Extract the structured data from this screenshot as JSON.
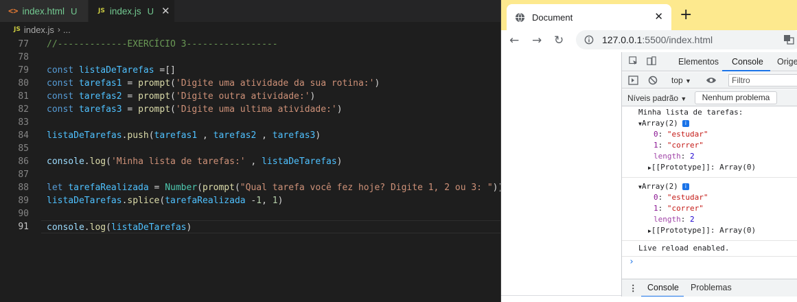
{
  "editor": {
    "tabs": [
      {
        "icon": "html-file-icon",
        "name": "index.html",
        "badge": "U"
      },
      {
        "icon": "js-file-icon",
        "name": "index.js",
        "badge": "U"
      }
    ],
    "js_badge": "JS",
    "breadcrumb": {
      "file": "index.js",
      "rest": "..."
    },
    "lines": [
      {
        "n": "77",
        "parts": [
          [
            "c-com",
            "//-------------EXERCÍCIO 3-----------------"
          ]
        ]
      },
      {
        "n": "78",
        "parts": []
      },
      {
        "n": "79",
        "parts": [
          [
            "c-kw",
            "const "
          ],
          [
            "c-var",
            "listaDeTarefas"
          ],
          [
            "c-p",
            " =[]"
          ]
        ]
      },
      {
        "n": "80",
        "parts": [
          [
            "c-kw",
            "const "
          ],
          [
            "c-var",
            "tarefas1"
          ],
          [
            "c-p",
            " = "
          ],
          [
            "c-fn",
            "prompt"
          ],
          [
            "c-p",
            "("
          ],
          [
            "c-str",
            "'Digite uma atividade da sua rotina:'"
          ],
          [
            "c-p",
            ")"
          ]
        ]
      },
      {
        "n": "81",
        "parts": [
          [
            "c-kw",
            "const "
          ],
          [
            "c-var",
            "tarefas2"
          ],
          [
            "c-p",
            " = "
          ],
          [
            "c-fn",
            "prompt"
          ],
          [
            "c-p",
            "("
          ],
          [
            "c-str",
            "'Digite outra atividade:'"
          ],
          [
            "c-p",
            ")"
          ]
        ]
      },
      {
        "n": "82",
        "parts": [
          [
            "c-kw",
            "const "
          ],
          [
            "c-var",
            "tarefas3"
          ],
          [
            "c-p",
            " = "
          ],
          [
            "c-fn",
            "prompt"
          ],
          [
            "c-p",
            "("
          ],
          [
            "c-str",
            "'Digite uma ultima atividade:'"
          ],
          [
            "c-p",
            ")"
          ]
        ]
      },
      {
        "n": "83",
        "parts": []
      },
      {
        "n": "84",
        "parts": [
          [
            "c-var",
            "listaDeTarefas"
          ],
          [
            "c-p",
            "."
          ],
          [
            "c-fn",
            "push"
          ],
          [
            "c-p",
            "("
          ],
          [
            "c-var",
            "tarefas1"
          ],
          [
            "c-p",
            " , "
          ],
          [
            "c-var",
            "tarefas2"
          ],
          [
            "c-p",
            " , "
          ],
          [
            "c-var",
            "tarefas3"
          ],
          [
            "c-p",
            ")"
          ]
        ]
      },
      {
        "n": "85",
        "parts": []
      },
      {
        "n": "86",
        "parts": [
          [
            "c-prop",
            "console"
          ],
          [
            "c-p",
            "."
          ],
          [
            "c-fn",
            "log"
          ],
          [
            "c-p",
            "("
          ],
          [
            "c-str",
            "'Minha lista de tarefas:'"
          ],
          [
            "c-p",
            " , "
          ],
          [
            "c-var",
            "listaDeTarefas"
          ],
          [
            "c-p",
            ")"
          ]
        ]
      },
      {
        "n": "87",
        "parts": []
      },
      {
        "n": "88",
        "parts": [
          [
            "c-kw",
            "let "
          ],
          [
            "c-var",
            "tarefaRealizada"
          ],
          [
            "c-p",
            " = "
          ],
          [
            "c-cls",
            "Number"
          ],
          [
            "c-p",
            "("
          ],
          [
            "c-fn",
            "prompt"
          ],
          [
            "c-p",
            "("
          ],
          [
            "c-str",
            "\"Qual tarefa você fez hoje? Digite 1, 2 ou 3: \""
          ],
          [
            "c-p",
            "))"
          ]
        ]
      },
      {
        "n": "89",
        "parts": [
          [
            "c-var",
            "listaDeTarefas"
          ],
          [
            "c-p",
            "."
          ],
          [
            "c-fn",
            "splice"
          ],
          [
            "c-p",
            "("
          ],
          [
            "c-var",
            "tarefaRealizada"
          ],
          [
            "c-p",
            " -"
          ],
          [
            "c-num",
            "1"
          ],
          [
            "c-p",
            ", "
          ],
          [
            "c-num",
            "1"
          ],
          [
            "c-p",
            ")"
          ]
        ]
      },
      {
        "n": "90",
        "parts": []
      },
      {
        "n": "91",
        "current": true,
        "parts": [
          [
            "c-prop",
            "console"
          ],
          [
            "c-p",
            "."
          ],
          [
            "c-fn",
            "log"
          ],
          [
            "c-p",
            "("
          ],
          [
            "c-var",
            "listaDeTarefas"
          ],
          [
            "c-p",
            ")"
          ]
        ]
      }
    ]
  },
  "browser": {
    "tab_title": "Document",
    "url_host": "127.0.0.1",
    "url_rest": ":5500/index.html",
    "devtools": {
      "tabs": [
        "Elementos",
        "Console",
        "Orige"
      ],
      "context": "top",
      "filter_placeholder": "Filtro",
      "levels": "Níveis padrão",
      "issues_button": "Nenhum problema",
      "drawer_tabs": [
        "Console",
        "Problemas"
      ],
      "console": {
        "log_label": "Minha lista de tarefas:",
        "array_label": "Array(2)",
        "info": "i",
        "items": [
          {
            "key": "0",
            "value": "\"estudar\""
          },
          {
            "key": "1",
            "value": "\"correr\""
          }
        ],
        "length_key": "length",
        "length_value": "2",
        "prototype_text": "[[Prototype]]: Array(0)",
        "live_reload": "Live reload enabled."
      }
    }
  }
}
